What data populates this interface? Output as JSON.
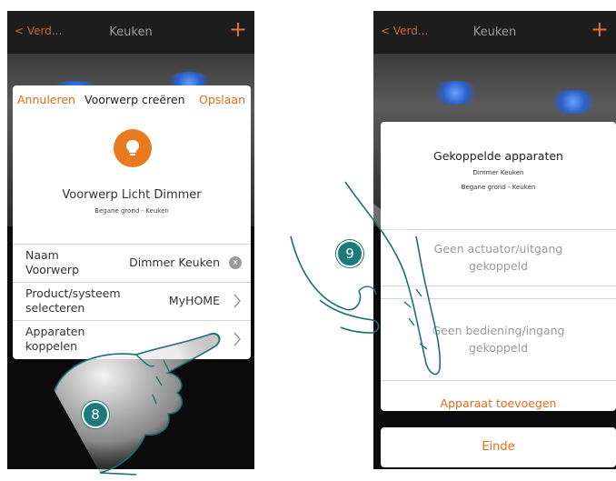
{
  "left_screen": {
    "nav": {
      "back_label": "< Verd...",
      "title": "Keuken",
      "plus": "+"
    },
    "header": {
      "cancel": "Annuleren",
      "title": "Voorwerp creëren",
      "save": "Opslaan"
    },
    "object": {
      "name": "Voorwerp Licht Dimmer",
      "location": "Begane grond - Keuken"
    },
    "rows": [
      {
        "label1": "Naam",
        "label2": "Voorwerp",
        "value": "Dimmer Keuken"
      },
      {
        "label1": "Product/systeem",
        "label2": "selecteren",
        "value": "MyHOME"
      },
      {
        "label1": "Apparaten",
        "label2": "koppelen",
        "value": ""
      }
    ],
    "step": "8"
  },
  "right_screen": {
    "nav": {
      "back_label": "< Verd...",
      "title": "Keuken",
      "plus": "+"
    },
    "card": {
      "title": "Gekoppelde apparaten",
      "sub1": "Dimmer Keuken",
      "sub2": "Begane grond - Keuken",
      "actuator_1": "Geen actuator/uitgang",
      "actuator_2": "gekoppeld",
      "control_1": "Geen bediening/ingang",
      "control_2": "gekoppeld",
      "add": "Apparaat toevoegen"
    },
    "done": "Einde",
    "step": "9"
  },
  "colors": {
    "accent": "#e06a1a",
    "step_badge": "#1e7a7a",
    "navbar": "#1d1d1d"
  },
  "icons": [
    "bulb-icon",
    "chevron-right-icon",
    "clear-icon",
    "hand-pointer-icon"
  ]
}
